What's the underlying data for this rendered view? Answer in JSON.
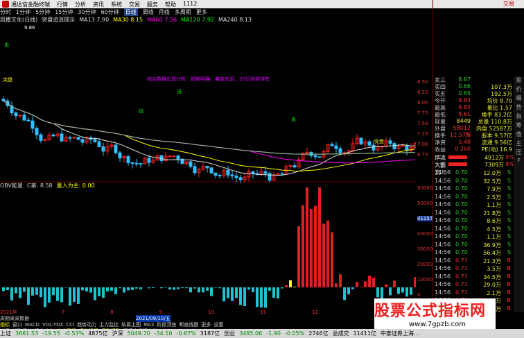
{
  "top": {
    "brand": "通达信金融终端",
    "menu": [
      "行情",
      "分析",
      "资讯",
      "系统",
      "交易",
      "服务",
      "帮助",
      "1112"
    ],
    "right": [
      "交易"
    ]
  },
  "periods": {
    "items": [
      "分时",
      "1分钟",
      "5分钟",
      "15分钟",
      "30分钟",
      "60分钟",
      "日线",
      "周线",
      "月线",
      "多周期",
      "更多"
    ],
    "active": "日线"
  },
  "ma_legend": [
    {
      "text": "凯撒文化(日线)",
      "color": "#dddddd"
    },
    {
      "text": "突盘追涨提示",
      "color": "#dddddd"
    },
    {
      "text": "MA13 7.90",
      "color": "#dddddd"
    },
    {
      "text": "MA30 8.15",
      "color": "#ffff00"
    },
    {
      "text": "MA60 7.56",
      "color": "#ff00ff"
    },
    {
      "text": "MA120 7.92",
      "color": "#00ff00"
    },
    {
      "text": "MA240 8.13",
      "color": "#dddddd"
    }
  ],
  "obv_legend": [
    {
      "text": "OBV能量",
      "color": "#ccc"
    },
    {
      "text": "C基: 8.58",
      "color": "#ccc"
    },
    {
      "text": "量入为主: 0.00",
      "color": "#ff0"
    }
  ],
  "annotations": {
    "peak": "9.86",
    "chu": "出",
    "tupan": "突盘",
    "signals": "综合数据出现分析：超势明确，量能充足，20日涨倍持有"
  },
  "right_axis": {
    "price": [
      "8.50",
      "8.25",
      "8.00",
      "7.75",
      "7.50",
      "7.25",
      "7.00",
      "6.75"
    ],
    "volume": [
      "60000",
      "50000",
      "41157",
      "40000",
      "30000",
      "20000",
      "10000",
      "0"
    ]
  },
  "quotes": [
    {
      "l": "卖三",
      "v": "8.67",
      "q": "",
      "c": "g"
    },
    {
      "l": "买四",
      "v": "0.66",
      "q": "107.3万",
      "c": "g"
    },
    {
      "l": "买五",
      "v": "0.65",
      "q": "192.5万",
      "c": "g"
    },
    {
      "l": "今开",
      "v": "8.83",
      "q": "均价 8.70",
      "c": "r"
    },
    {
      "l": "最高",
      "v": "8.83",
      "q": "量比 1.57",
      "c": "r"
    },
    {
      "l": "最低",
      "v": "8.61",
      "q": "换手 83.2亿",
      "c": "r"
    },
    {
      "l": "现量",
      "v": "8449",
      "q": "总量 110.8万",
      "c": "y"
    },
    {
      "l": "外盘",
      "v": "58012万",
      "q": "内盘 52587万",
      "c": "r"
    },
    {
      "l": "换手",
      "v": "11.57%",
      "q": "股本 9.57亿",
      "c": "r"
    },
    {
      "l": "净资",
      "v": "5.48",
      "q": "流通 9.56亿",
      "c": "r"
    },
    {
      "l": "收益(二)",
      "v": "0.260",
      "q": "PE(动) 16.9",
      "c": "r"
    }
  ],
  "flow": [
    {
      "l": "净流入额",
      "v": "4912万",
      "p": "5%"
    },
    {
      "l": "大宗流入",
      "v": "7309万",
      "p": "8%"
    }
  ],
  "ticks": [
    {
      "t": "14:56",
      "p": "0.70",
      "n": "12.0万",
      "s": "S"
    },
    {
      "t": "14:56",
      "p": "0.70",
      "n": "32.5万",
      "s": "S"
    },
    {
      "t": "14:56",
      "p": "0.70",
      "n": "7.9万",
      "s": "S"
    },
    {
      "t": "14:56",
      "p": "0.70",
      "n": "2.5万",
      "s": "S"
    },
    {
      "t": "14:56",
      "p": "0.70",
      "n": "1.1万",
      "s": "S"
    },
    {
      "t": "14:56",
      "p": "0.70",
      "n": "21.8万",
      "s": "S"
    },
    {
      "t": "14:56",
      "p": "0.70",
      "n": "8.6万",
      "s": "S"
    },
    {
      "t": "14:56",
      "p": "0.70",
      "n": "4.5万",
      "s": "S"
    },
    {
      "t": "14:56",
      "p": "0.70",
      "n": "1.1万",
      "s": "S"
    },
    {
      "t": "14:56",
      "p": "0.70",
      "n": "36.9万",
      "s": "S"
    },
    {
      "t": "14:56",
      "p": "0.70",
      "n": "56.4万",
      "s": "S"
    },
    {
      "t": "14:56",
      "p": "0.71",
      "n": "21.3万",
      "s": "B"
    },
    {
      "t": "14:56",
      "p": "0.71",
      "n": "3.5万",
      "s": "B"
    },
    {
      "t": "14:56",
      "p": "0.71",
      "n": "34.5万",
      "s": "B"
    },
    {
      "t": "14:56",
      "p": "0.71",
      "n": "29.0万",
      "s": "B"
    },
    {
      "t": "14:56",
      "p": "0.71",
      "n": "2.1万",
      "s": "B"
    },
    {
      "t": "14:56",
      "p": "0.71",
      "n": "1.1万",
      "s": "B"
    },
    {
      "t": "14:56",
      "p": "0.71",
      "n": "31.5万",
      "s": "B"
    }
  ],
  "side_tabs": [
    "笔",
    "价",
    "细",
    "势",
    "指",
    "筹",
    "值",
    "主",
    "压",
    "F"
  ],
  "bottom": {
    "row0": [
      "2021年",
      "7",
      "8",
      "9",
      "10",
      "11",
      "12"
    ],
    "row1_label": "周期来来数据",
    "date_highlight": "2021/09/10/五",
    "row2": [
      "指标",
      "窗口",
      "MACD",
      "VOL-TDX",
      "CCI",
      "趋势动力",
      "主力监控",
      "私募主图",
      "MA2",
      "阶段顶底",
      "断底线图",
      "更多",
      "设置"
    ],
    "row3": [
      "扩展",
      "关联报价",
      "资金分布",
      "综合资讯",
      "行业资讯",
      "反动问答",
      "帮用户提问专带"
    ]
  },
  "status": [
    {
      "t": "上证",
      "c": "k"
    },
    {
      "t": "3661.53",
      "c": "d"
    },
    {
      "t": "-19.55",
      "c": "d"
    },
    {
      "t": "-0.53%",
      "c": "d"
    },
    {
      "t": "4875亿",
      "c": "k"
    },
    {
      "t": "沪深",
      "c": "k"
    },
    {
      "t": "5049.70",
      "c": "d"
    },
    {
      "t": "-34.10",
      "c": "d"
    },
    {
      "t": "-0.67%",
      "c": "d"
    },
    {
      "t": "3187亿",
      "c": "k"
    },
    {
      "t": "创业",
      "c": "k"
    },
    {
      "t": "3495.06",
      "c": "d"
    },
    {
      "t": "-1.90",
      "c": "d"
    },
    {
      "t": "-0.05%",
      "c": "d"
    },
    {
      "t": "2746亿",
      "c": "k"
    },
    {
      "t": "总成交",
      "c": "k"
    },
    {
      "t": "11411亿",
      "c": "k"
    },
    {
      "t": "中泰证券上海...",
      "c": "k"
    }
  ],
  "watermark": {
    "big": "股票公式指标网",
    "url": "www.7gpzb.com"
  },
  "colors": {
    "up": "#ff2020",
    "down": "#30c0ff",
    "upvol": "#e02020",
    "downvol": "#20c0d0"
  }
}
